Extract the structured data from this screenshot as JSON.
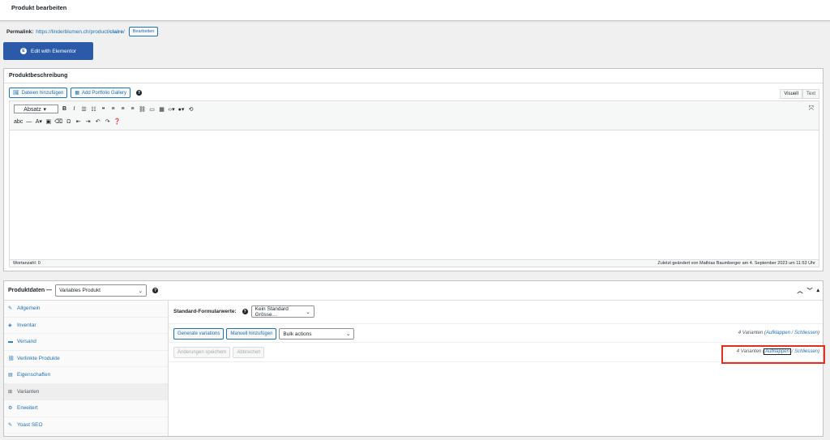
{
  "header": {
    "title": "Produkt bearbeiten"
  },
  "permalink": {
    "label": "Permalink:",
    "url_prefix": "https://linderblumen.ch/product/",
    "slug": "claire",
    "url_suffix": "/",
    "edit_label": "Bearbeiten"
  },
  "elementor": {
    "label": "Edit with Elementor"
  },
  "description": {
    "title": "Produktbeschreibung",
    "add_media": "Dateien hinzufügen",
    "add_gallery": "Add Portfolio Gallery",
    "tab_visual": "Visuell",
    "tab_text": "Text",
    "format": "Absatz",
    "word_count": "Wortanzahl: 0",
    "last_edited": "Zuletzt geändert von Mathias Baumberger am 4. September 2023 um 11:53 Uhr"
  },
  "product_data": {
    "title": "Produktdaten —",
    "type": "Variables Produkt",
    "tabs": [
      "Allgemein",
      "Inventar",
      "Versand",
      "Verlinkte Produkte",
      "Eigenschaften",
      "Varianten",
      "Erweitert",
      "Yoast SEO"
    ],
    "default_label": "Standard-Formularwerte:",
    "default_value": "Kein Standard Grösse…",
    "generate": "Generate variations",
    "manual": "Manuell hinzufügen",
    "bulk": "Bulk actions",
    "variants_count": "4 Varianten",
    "expand": "Aufklappen",
    "close": "Schliessen",
    "save": "Änderungen speichern",
    "cancel": "Abbrechen"
  },
  "colors": {
    "accent": "#2271b1",
    "elementor": "#2b5ba8",
    "highlight": "#e0301e"
  }
}
